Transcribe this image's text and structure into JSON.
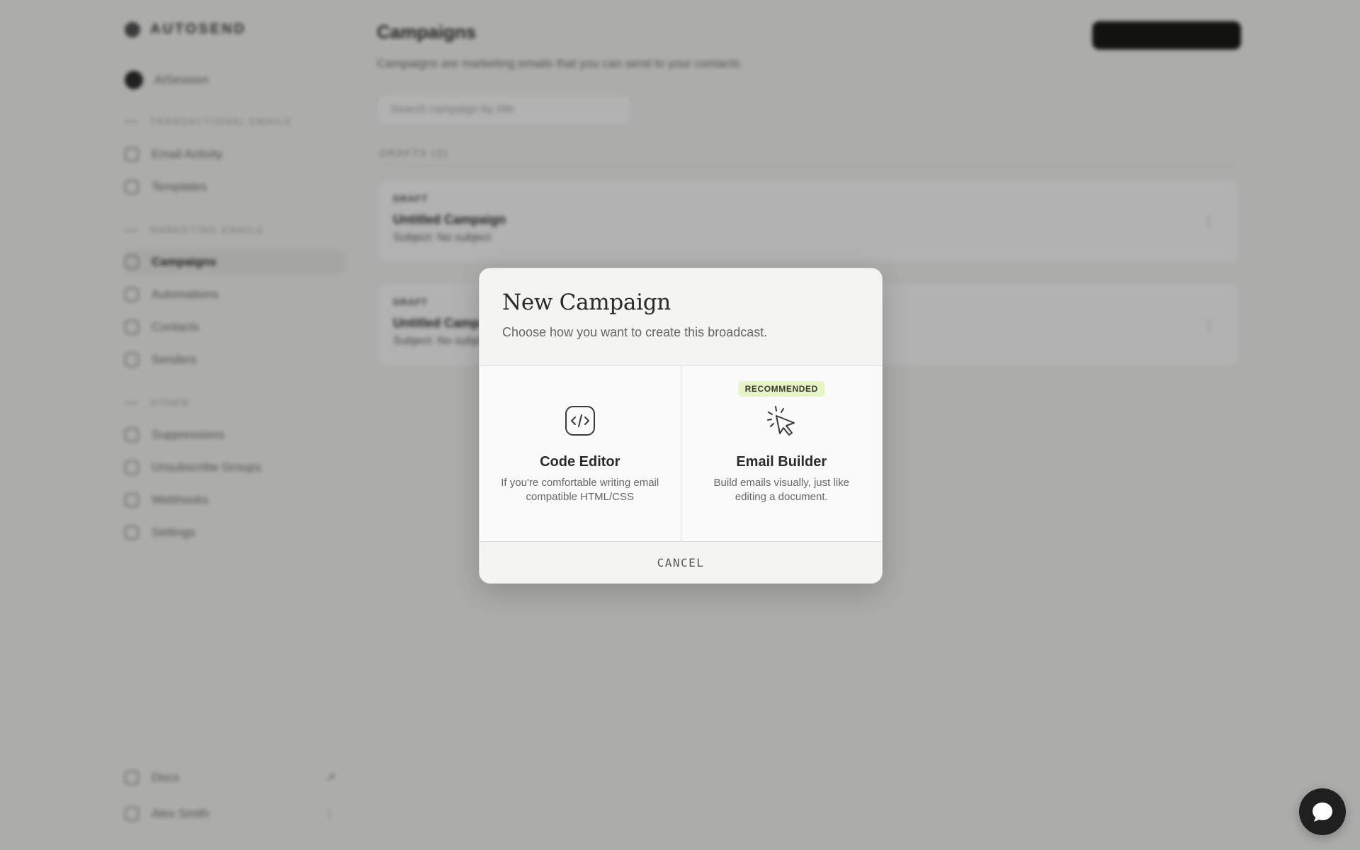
{
  "background": {
    "brand": "AUTOSEND",
    "account": "AISession",
    "sidebar": {
      "section1": "TRANSACTIONAL EMAILS",
      "section1_items": [
        "Email Activity",
        "Templates"
      ],
      "section2": "MARKETING EMAILS",
      "section2_items": [
        "Campaigns",
        "Automations",
        "Contacts",
        "Senders"
      ],
      "section3": "OTHER",
      "section3_items": [
        "Suppressions",
        "Unsubscribe Groups",
        "Webhooks",
        "Settings"
      ],
      "footer_items": [
        {
          "label": "Docs",
          "right": "↗"
        },
        {
          "label": "Alex Smith",
          "right": "⋮"
        }
      ]
    },
    "main": {
      "title": "Campaigns",
      "subtitle": "Campaigns are marketing emails that you can send to your contacts.",
      "search_placeholder": "Search campaign by title",
      "group_header": "DRAFTS (2)",
      "cards": [
        {
          "badge": "DRAFT",
          "title": "Untitled Campaign",
          "subject": "Subject: No subject"
        },
        {
          "badge": "DRAFT",
          "title": "Untitled Campaign",
          "subject": "Subject: No subject"
        }
      ]
    }
  },
  "modal": {
    "title": "New Campaign",
    "subtitle": "Choose how you want to create this broadcast.",
    "options": [
      {
        "title": "Code Editor",
        "desc": "If you're comfortable writing email compatible HTML/CSS",
        "icon": "code-icon"
      },
      {
        "title": "Email Builder",
        "desc": "Build emails visually, just like editing a document.",
        "icon": "cursor-click-icon",
        "badge": "RECOMMENDED"
      }
    ],
    "cancel": "CANCEL"
  },
  "chat_icon": "chat-bubble-icon",
  "colors": {
    "overlay": "#000000",
    "badge_bg": "#e7f4c8",
    "chat_bg": "#1f1f1f"
  }
}
